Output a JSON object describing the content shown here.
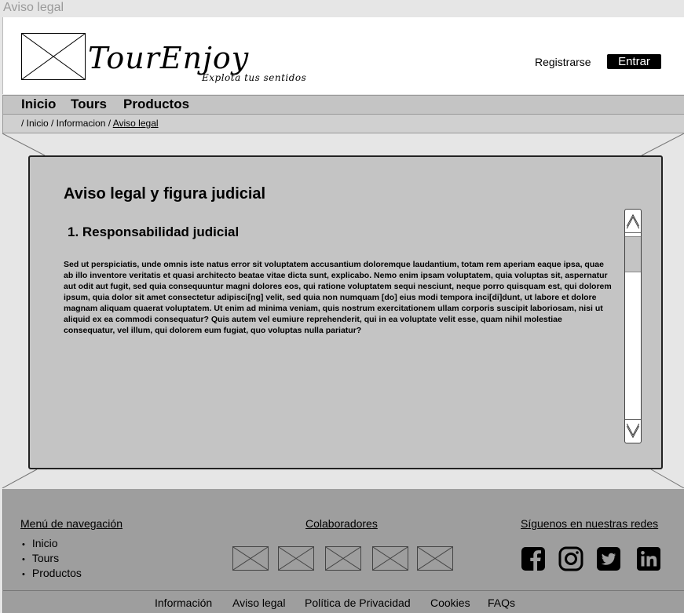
{
  "window": {
    "title": "Aviso legal"
  },
  "brand": {
    "name": "TourEnjoy",
    "tagline": "Explota tus sentidos"
  },
  "header": {
    "register_label": "Registrarse",
    "login_label": "Entrar"
  },
  "nav": {
    "items": [
      {
        "label": "Inicio"
      },
      {
        "label": "Tours"
      },
      {
        "label": "Productos"
      }
    ]
  },
  "breadcrumb": {
    "prefix": "/ Inicio / Informacion / ",
    "current": "Aviso legal"
  },
  "content": {
    "title": "Aviso legal y figura judicial",
    "section_title": "1.  Responsabilidad judicial",
    "body": "Sed ut perspiciatis, unde omnis iste natus error sit voluptatem accusantium doloremque laudantium, totam rem aperiam eaque ipsa, quae ab illo inventore veritatis et quasi architecto beatae vitae dicta sunt, explicabo. Nemo enim ipsam voluptatem, quia voluptas sit, aspernatur aut odit aut fugit, sed quia consequuntur magni dolores eos, qui ratione voluptatem sequi nesciunt, neque porro quisquam est, qui dolorem ipsum, quia dolor sit amet consectetur adipisci[ng] velit, sed quia non numquam  [do] eius modi tempora inci[di]dunt, ut labore et dolore magnam aliquam quaerat voluptatem. Ut enim ad minima veniam, quis nostrum exercitationem ullam corporis suscipit laboriosam, nisi ut aliquid ex ea commodi consequatur? Quis autem vel eumiure reprehenderit, qui in ea voluptate velit esse, quam nihil molestiae consequatur, vel illum, qui dolorem eum fugiat, quo voluptas nulla pariatur?"
  },
  "footer": {
    "nav_heading": "Menú de navegación",
    "nav_items": [
      {
        "label": "Inicio"
      },
      {
        "label": "Tours"
      },
      {
        "label": "Productos"
      }
    ],
    "collab_heading": "Colaboradores",
    "social_heading": "Síguenos en nuestras redes",
    "social": [
      {
        "icon": "facebook-icon"
      },
      {
        "icon": "instagram-icon"
      },
      {
        "icon": "twitter-icon"
      },
      {
        "icon": "linkedin-icon"
      }
    ],
    "links": [
      {
        "label": "Información"
      },
      {
        "label": "Aviso legal"
      },
      {
        "label": "Política de Privacidad"
      },
      {
        "label": "Cookies"
      },
      {
        "label": "FAQs"
      }
    ]
  }
}
